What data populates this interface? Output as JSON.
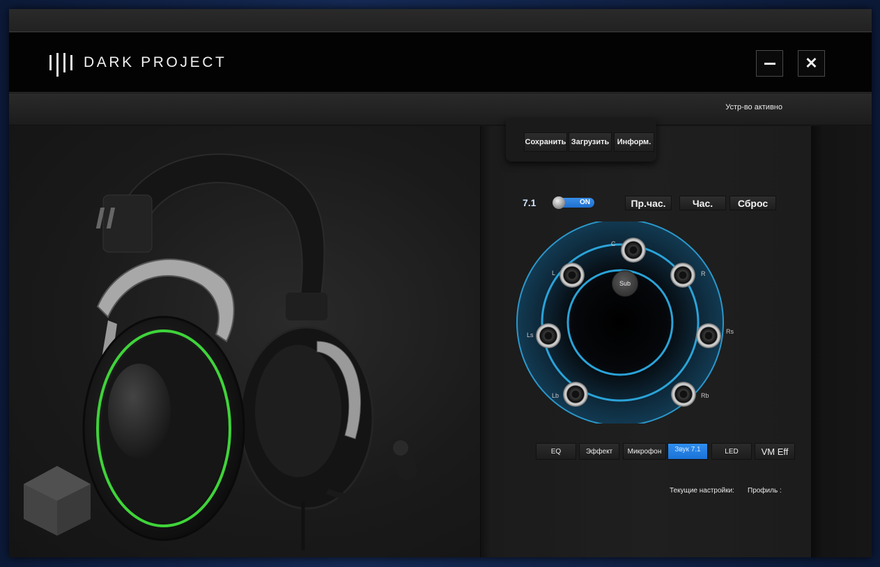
{
  "app": {
    "brand": "DARK PROJECT"
  },
  "window_controls": {
    "minimize_icon": "minimize-icon",
    "close_icon": "close-icon"
  },
  "status": {
    "text": "Устр-во активно"
  },
  "file_buttons": {
    "save": "Сохранить",
    "load": "Загрузить",
    "info": "Информ."
  },
  "surround": {
    "mode_label": "7.1",
    "toggle_state": "ON",
    "clockwise": "Пр.час.",
    "counterclockwise": "Час.",
    "reset": "Сброс"
  },
  "speakers": {
    "center": "C",
    "left": "L",
    "right": "R",
    "left_surround": "Ls",
    "right_surround": "Rs",
    "left_back": "Lb",
    "right_back": "Rb",
    "sub": "Sub"
  },
  "tabs": [
    {
      "label": "EQ"
    },
    {
      "label": "Эффект"
    },
    {
      "label": "Микрофон"
    },
    {
      "label": "Звук 7.1"
    },
    {
      "label": "LED"
    },
    {
      "label": "VM Eff"
    }
  ],
  "active_tab": "Звук 7.1",
  "footer": {
    "current_settings": "Текущие настройки:",
    "profile": "Профиль :"
  },
  "colors": {
    "accent_blue": "#1f6fd0",
    "ring_glow": "#2aa3d8",
    "headset_led": "#3fd43a"
  }
}
